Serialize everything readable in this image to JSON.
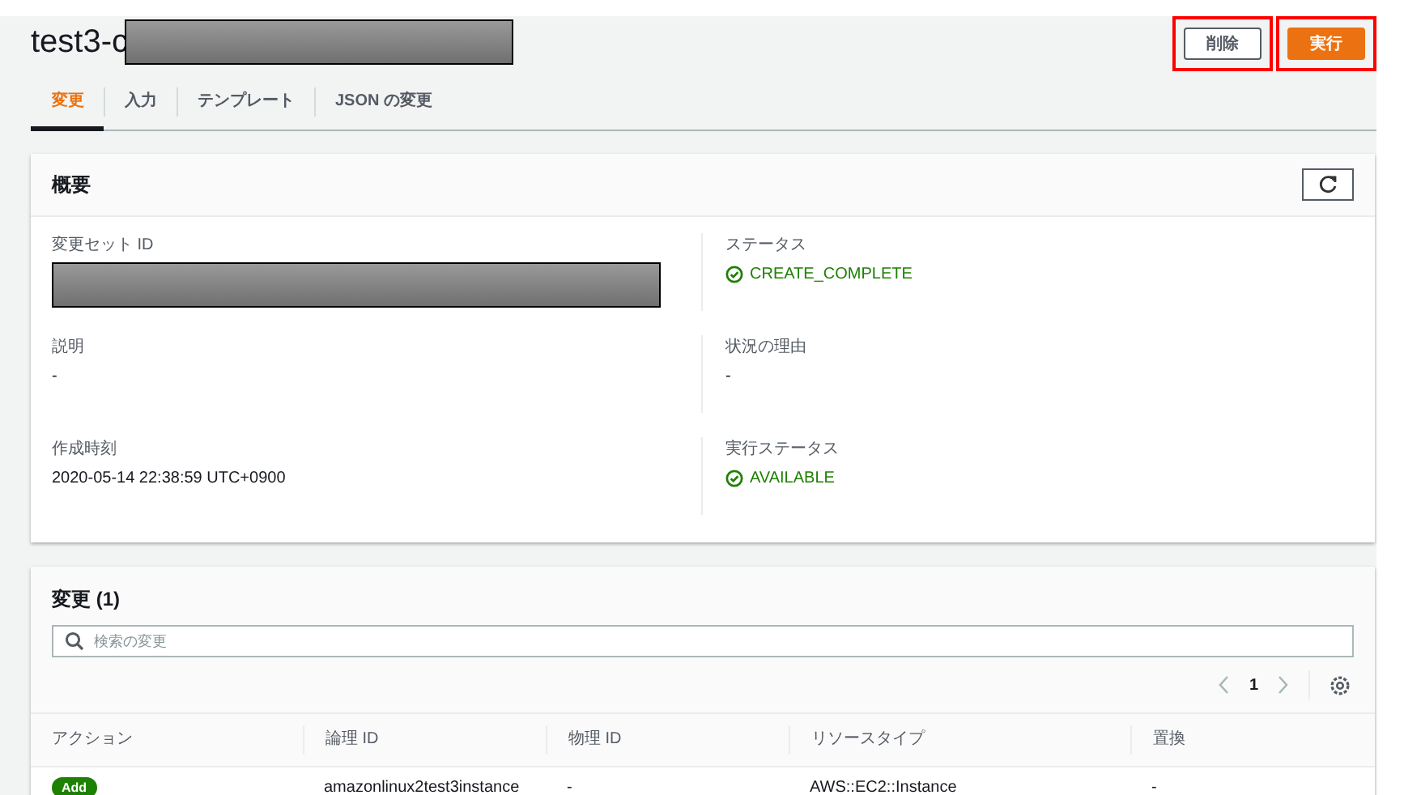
{
  "header": {
    "title": "test3-c",
    "title_redacted": true,
    "buttons": [
      {
        "label": "削除",
        "kind": "secondary",
        "highlighted": true
      },
      {
        "label": "実行",
        "kind": "primary",
        "highlighted": true
      }
    ]
  },
  "tabs": [
    {
      "label": "変更",
      "selected": true
    },
    {
      "label": "入力",
      "selected": false
    },
    {
      "label": "テンプレート",
      "selected": false
    },
    {
      "label": "JSON の変更",
      "selected": false
    }
  ],
  "overview": {
    "title": "概要",
    "columns": [
      [
        {
          "label": "変更セット ID",
          "kind": "redacted"
        },
        {
          "label": "説明",
          "kind": "text",
          "value": "-"
        },
        {
          "label": "作成時刻",
          "kind": "text",
          "value": "2020-05-14 22:38:59 UTC+0900"
        }
      ],
      [
        {
          "label": "ステータス",
          "kind": "status",
          "value": "CREATE_COMPLETE"
        },
        {
          "label": "状況の理由",
          "kind": "text",
          "value": "-"
        },
        {
          "label": "実行ステータス",
          "kind": "status",
          "value": "AVAILABLE"
        }
      ]
    ]
  },
  "changes": {
    "title": "変更",
    "count": "(1)",
    "search": {
      "placeholder": "検索の変更"
    },
    "pagination": {
      "page": "1"
    },
    "table": {
      "columns": [
        "アクション",
        "論理 ID",
        "物理 ID",
        "リソースタイプ",
        "置換"
      ],
      "rows": [
        {
          "action": "Add",
          "logical_id": "amazonlinux2test3instance",
          "physical_id": "-",
          "resource_type": "AWS::EC2::Instance",
          "replacement": "-"
        }
      ]
    }
  }
}
